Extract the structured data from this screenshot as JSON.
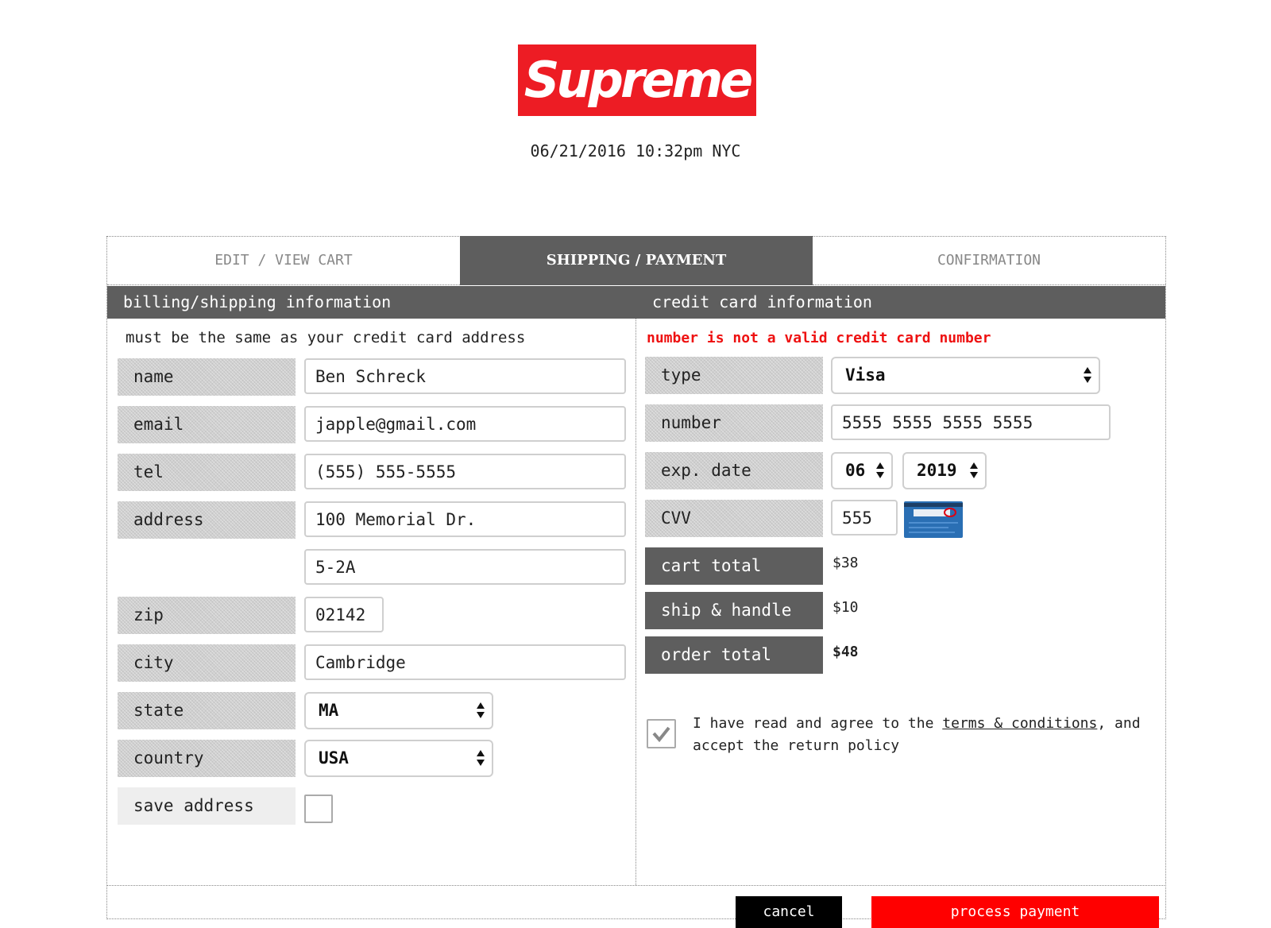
{
  "logo": {
    "text": "Supreme",
    "color": "#ed1c24"
  },
  "datetime": "06/21/2016 10:32pm NYC",
  "tabs": [
    {
      "label": "EDIT / VIEW CART",
      "active": false
    },
    {
      "label": "SHIPPING / PAYMENT",
      "active": true
    },
    {
      "label": "CONFIRMATION",
      "active": false
    }
  ],
  "billing": {
    "title": "billing/shipping information",
    "note": "must be the same as your credit card address",
    "fields": {
      "name": {
        "label": "name",
        "value": "Ben Schreck"
      },
      "email": {
        "label": "email",
        "value": "japple@gmail.com"
      },
      "tel": {
        "label": "tel",
        "value": "(555) 555-5555"
      },
      "address": {
        "label": "address",
        "value": "100 Memorial Dr.",
        "value2": "5-2A"
      },
      "zip": {
        "label": "zip",
        "value": "02142"
      },
      "city": {
        "label": "city",
        "value": "Cambridge"
      },
      "state": {
        "label": "state",
        "value": "MA"
      },
      "country": {
        "label": "country",
        "value": "USA"
      },
      "save_address": {
        "label": "save address",
        "checked": false
      }
    }
  },
  "card": {
    "title": "credit card information",
    "error": "number is not a valid credit card number",
    "error_color": "#ee1111",
    "fields": {
      "type": {
        "label": "type",
        "value": "Visa"
      },
      "number": {
        "label": "number",
        "value": "5555 5555 5555 5555"
      },
      "exp": {
        "label": "exp. date",
        "month": "06",
        "year": "2019"
      },
      "cvv": {
        "label": "CVV",
        "value": "555"
      }
    },
    "totals": {
      "cart_total": {
        "label": "cart total",
        "value": "$38"
      },
      "ship_handle": {
        "label": "ship & handle",
        "value": "$10"
      },
      "order_total": {
        "label": "order total",
        "value": "$48"
      }
    },
    "agree": {
      "checked": true,
      "text_before": "I have read and agree to the ",
      "link": "terms & conditions",
      "text_after": ", and accept the return policy"
    }
  },
  "buttons": {
    "cancel": "cancel",
    "process": "process payment"
  }
}
